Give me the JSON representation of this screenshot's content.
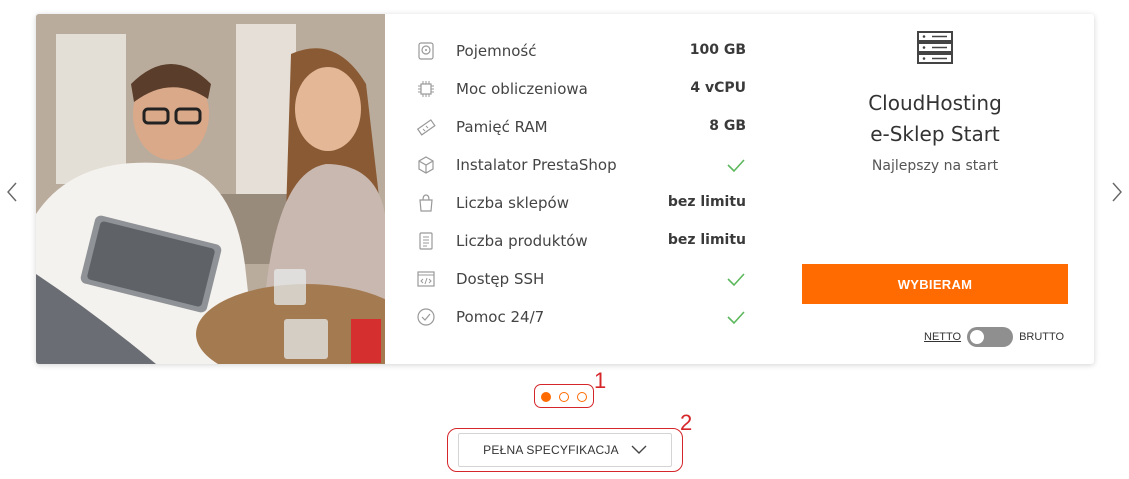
{
  "specs": [
    {
      "icon": "disk-icon",
      "label": "Pojemność",
      "value": "100 GB",
      "check": false
    },
    {
      "icon": "cpu-icon",
      "label": "Moc obliczeniowa",
      "value": "4 vCPU",
      "check": false
    },
    {
      "icon": "ram-icon",
      "label": "Pamięć RAM",
      "value": "8 GB",
      "check": false
    },
    {
      "icon": "box-icon",
      "label": "Instalator PrestaShop",
      "value": "",
      "check": true
    },
    {
      "icon": "bag-icon",
      "label": "Liczba sklepów",
      "value": "bez limitu",
      "check": false
    },
    {
      "icon": "list-icon",
      "label": "Liczba produktów",
      "value": "bez limitu",
      "check": false
    },
    {
      "icon": "code-window-icon",
      "label": "Dostęp SSH",
      "value": "",
      "check": true
    },
    {
      "icon": "check-circle-icon",
      "label": "Pomoc 24/7",
      "value": "",
      "check": true
    }
  ],
  "plan": {
    "icon": "server-icon",
    "name_line1": "CloudHosting",
    "name_line2": "e-Sklep Start",
    "tagline": "Najlepszy na start",
    "cta_label": "WYBIERAM",
    "toggle_left": "NETTO",
    "toggle_right": "BRUTTO"
  },
  "pagination": {
    "count": 3,
    "active": 1,
    "annotation": "1"
  },
  "spec_button": {
    "label": "PEŁNA SPECYFIKACJA",
    "annotation": "2"
  },
  "colors": {
    "accent": "#ff6b00",
    "check": "#5cb85c",
    "annotation": "#d5262a"
  }
}
